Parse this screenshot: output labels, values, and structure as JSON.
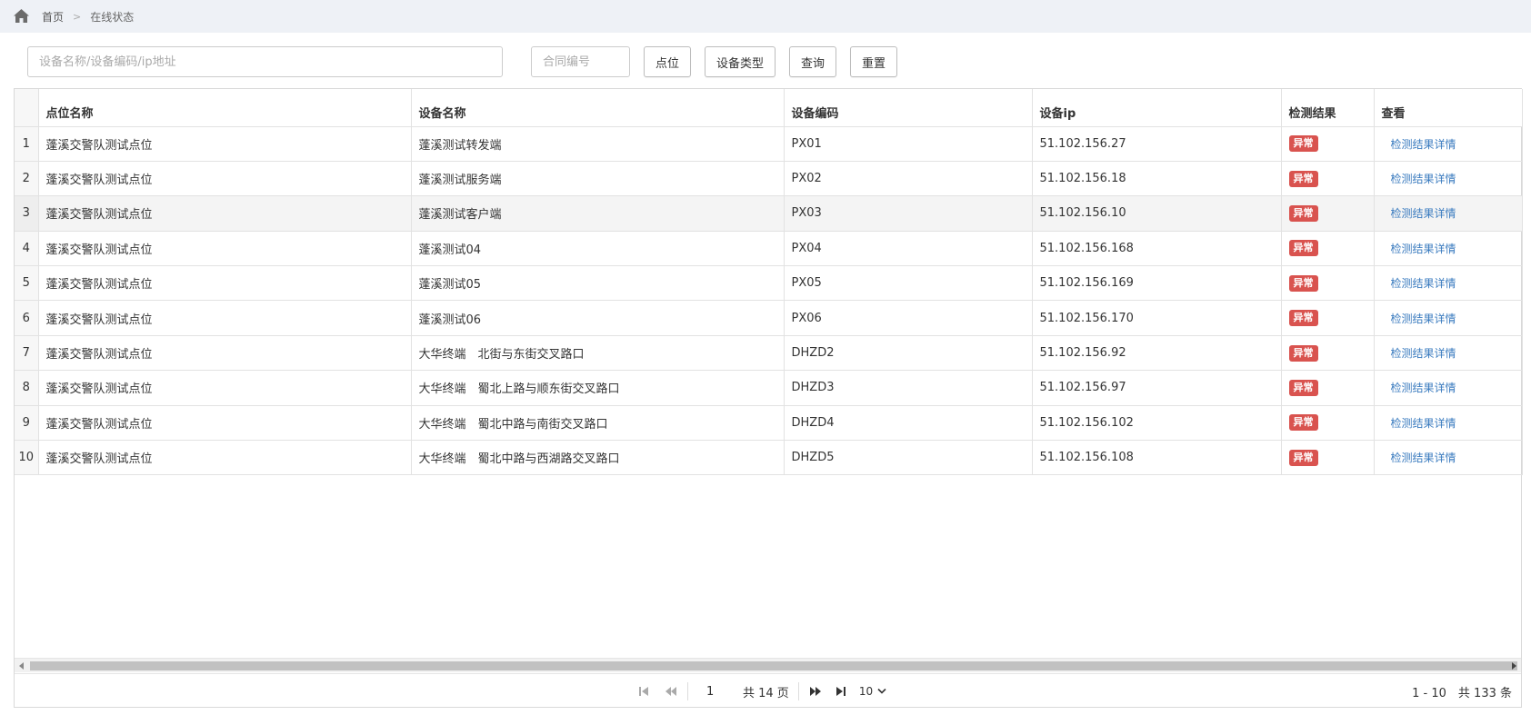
{
  "breadcrumb": {
    "home": "首页",
    "separator": ">",
    "current": "在线状态"
  },
  "toolbar": {
    "search_placeholder": "设备名称/设备编码/ip地址",
    "contract_placeholder": "合同编号",
    "point_btn": "点位",
    "device_type_btn": "设备类型",
    "query_btn": "查询",
    "reset_btn": "重置"
  },
  "table": {
    "columns": [
      "点位名称",
      "设备名称",
      "设备编码",
      "设备ip",
      "检测结果",
      "查看"
    ],
    "rows": [
      {
        "idx": "1",
        "point": "蓬溪交警队测试点位",
        "device": "蓬溪测试转发端",
        "code": "PX01",
        "ip": "51.102.156.27",
        "result": "异常",
        "link": "检测结果详情"
      },
      {
        "idx": "2",
        "point": "蓬溪交警队测试点位",
        "device": "蓬溪测试服务端",
        "code": "PX02",
        "ip": "51.102.156.18",
        "result": "异常",
        "link": "检测结果详情"
      },
      {
        "idx": "3",
        "point": "蓬溪交警队测试点位",
        "device": "蓬溪测试客户端",
        "code": "PX03",
        "ip": "51.102.156.10",
        "result": "异常",
        "link": "检测结果详情"
      },
      {
        "idx": "4",
        "point": "蓬溪交警队测试点位",
        "device": "蓬溪测试04",
        "code": "PX04",
        "ip": "51.102.156.168",
        "result": "异常",
        "link": "检测结果详情"
      },
      {
        "idx": "5",
        "point": "蓬溪交警队测试点位",
        "device": "蓬溪测试05",
        "code": "PX05",
        "ip": "51.102.156.169",
        "result": "异常",
        "link": "检测结果详情"
      },
      {
        "idx": "6",
        "point": "蓬溪交警队测试点位",
        "device": "蓬溪测试06",
        "code": "PX06",
        "ip": "51.102.156.170",
        "result": "异常",
        "link": "检测结果详情"
      },
      {
        "idx": "7",
        "point": "蓬溪交警队测试点位",
        "device": "大华终端　北街与东街交叉路口",
        "code": "DHZD2",
        "ip": "51.102.156.92",
        "result": "异常",
        "link": "检测结果详情"
      },
      {
        "idx": "8",
        "point": "蓬溪交警队测试点位",
        "device": "大华终端　蜀北上路与顺东街交叉路口",
        "code": "DHZD3",
        "ip": "51.102.156.97",
        "result": "异常",
        "link": "检测结果详情"
      },
      {
        "idx": "9",
        "point": "蓬溪交警队测试点位",
        "device": "大华终端　蜀北中路与南街交叉路口",
        "code": "DHZD4",
        "ip": "51.102.156.102",
        "result": "异常",
        "link": "检测结果详情"
      },
      {
        "idx": "10",
        "point": "蓬溪交警队测试点位",
        "device": "大华终端　蜀北中路与西湖路交叉路口",
        "code": "DHZD5",
        "ip": "51.102.156.108",
        "result": "异常",
        "link": "检测结果详情"
      }
    ]
  },
  "colors": {
    "badge": "#d9534f",
    "link": "#3a7bbf",
    "breadcrumb_bg": "#eef1f6"
  },
  "pager": {
    "current_page": "1",
    "total_pages_text": "共 14 页",
    "page_size": "10",
    "range_text": "1 - 10　共 133 条"
  }
}
